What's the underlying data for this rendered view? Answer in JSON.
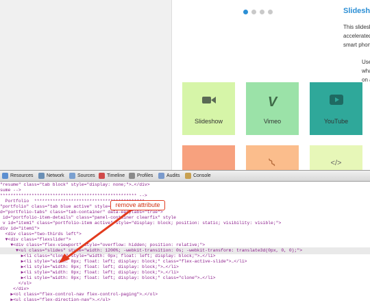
{
  "slider": {
    "dot_count": 4,
    "active_index": 0,
    "active_color": "#2c8fd5",
    "inactive_color": "#c9c9c9"
  },
  "sidebar": {
    "title": "Slidesho",
    "lines": [
      "This slidesh",
      "accelerated",
      "smart phon"
    ],
    "lines2": [
      "Use",
      "wha",
      "on a"
    ]
  },
  "tiles": [
    {
      "label": "Slideshow",
      "icon": "video-camera-icon",
      "glyph": "▶",
      "color": "#d6f5a8"
    },
    {
      "label": "Vimeo",
      "icon": "vimeo-icon",
      "glyph": "V",
      "color": "#9be2a8"
    },
    {
      "label": "YouTube",
      "icon": "youtube-icon",
      "glyph": "▶",
      "color": "#2fa89a"
    },
    {
      "label": "",
      "icon": "",
      "glyph": "",
      "color": "#f7a17e"
    },
    {
      "label": "",
      "icon": "paperclip-icon",
      "glyph": "⌇",
      "color": "#fbbd8c"
    },
    {
      "label": "",
      "icon": "code-icon",
      "glyph": "</>",
      "color": "#e7f7b8"
    }
  ],
  "devtools": {
    "toolbar": [
      {
        "label": "Resources",
        "icon": "resources-icon",
        "color": "#5b8ed0"
      },
      {
        "label": "Network",
        "icon": "network-icon",
        "color": "#6a8fb5"
      },
      {
        "label": "Sources",
        "icon": "sources-icon",
        "color": "#7aa0d0"
      },
      {
        "label": "Timeline",
        "icon": "timeline-icon",
        "color": "#d04a4a"
      },
      {
        "label": "Profiles",
        "icon": "profiles-icon",
        "color": "#8a8a8a"
      },
      {
        "label": "Audits",
        "icon": "audits-icon",
        "color": "#7a9acc"
      },
      {
        "label": "Console",
        "icon": "console-icon",
        "color": "#c8a050"
      }
    ],
    "code_lines": [
      "\"resume\" class=\"tab block\" style=\"display: none;\">…</div>",
      "sume -->",
      "**************************************************** -->",
      "  Portfolio  ******************************************",
      "\"portfolio\" class=\"tab blue active\" style=\"display: block;\">",
      "d=\"portfolio-tabs\" class=\"tab-container\" data-easytabs=\"true\">",
      " id=\"portfolio-item-details\" class=\"panel-container clearfix\" style",
      " v id=\"item1\" class=\"portfolio-item active\" style=\"display: block; position: static; visibility: visible;\">",
      "div id=\"item1\">",
      "  <div class=\"two-thirds left\">",
      "  ▼<div class=\"flexslider\">",
      "    ▼<div class=\"flex-viewport\" style=\"overflow: hidden; position: relative;\">",
      "      ▼<ul class=\"slides\" style=\"width: 1200%; -webkit-transition: 0s; -webkit-transform: translate3d(0px, 0, 0);\">",
      "        ▶<li class=\"clone\" style=\"width: 0px; float: left; display: block;\">…</li>",
      "        ▶<li style=\"width: 0px; float: left; display: block;\" class=\"flex-active-slide\">…</li>",
      "        ▶<li style=\"width: 0px; float: left; display: block;\">…</li>",
      "        ▶<li style=\"width: 0px; float: left; display: block;\">…</li>",
      "        ▶<li style=\"width: 0px; float: left; display: block;\" class=\"clone\">…</li>",
      "       </ul>",
      "     </div>",
      "    ▶<ol class=\"flex-control-nav flex-control-paging\">…</ol>",
      "    ▶<ul class=\"flex-direction-nav\">…</ul>"
    ],
    "highlight_line": 12
  },
  "annotation": {
    "text": "remove attribute",
    "color": "#e23b1e"
  }
}
